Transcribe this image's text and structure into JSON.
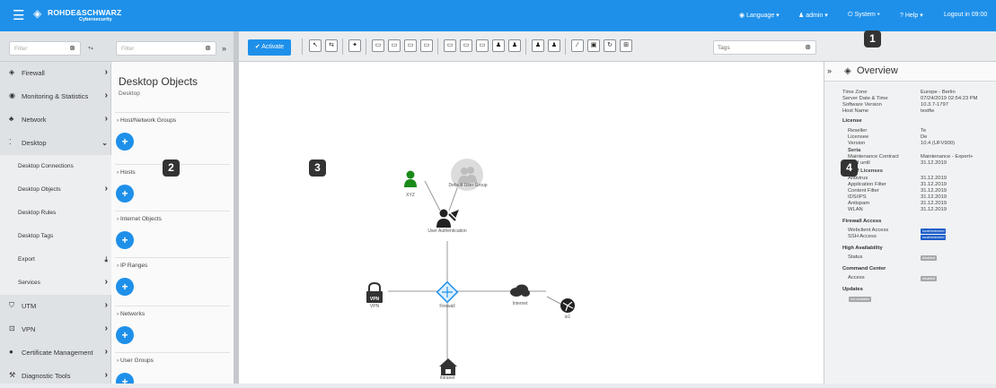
{
  "app": {
    "brand": "ROHDE&SCHWARZ",
    "subbrand": "Cybersecurity"
  },
  "topbar": {
    "language": "Language ▾",
    "user": "admin ▾",
    "system": "System ▾",
    "help": "Help ▾",
    "logout": "Logout in 09:00"
  },
  "filters": {
    "nav_placeholder": "Filter",
    "objects_placeholder": "Filter",
    "tags_placeholder": "Tags"
  },
  "nav": {
    "items": [
      {
        "label": "Firewall"
      },
      {
        "label": "Monitoring & Statistics"
      },
      {
        "label": "Network"
      },
      {
        "label": "Desktop"
      },
      {
        "label": "Desktop Connections"
      },
      {
        "label": "Desktop Objects"
      },
      {
        "label": "Desktop Rules"
      },
      {
        "label": "Desktop Tags"
      },
      {
        "label": "Export"
      },
      {
        "label": "Services"
      },
      {
        "label": "UTM"
      },
      {
        "label": "VPN"
      },
      {
        "label": "Certificate Management"
      },
      {
        "label": "Diagnostic Tools"
      }
    ]
  },
  "objects_panel": {
    "title": "Desktop Objects",
    "subtitle": "Desktop",
    "groups": [
      {
        "label": "Host/Network Groups"
      },
      {
        "label": "Hosts"
      },
      {
        "label": "Internet Objects"
      },
      {
        "label": "IP Ranges"
      },
      {
        "label": "Networks"
      },
      {
        "label": "User Groups"
      }
    ]
  },
  "toolbar": {
    "activate_label": "Activate"
  },
  "canvas": {
    "nodes": {
      "xyz": "XYZ",
      "default_user_group": "Default User Group",
      "user_auth": "User Authentication",
      "vpn": "VPN",
      "firewall": "Firewall",
      "internet": "Internet",
      "io1": "io1",
      "intranet": "Intranet"
    }
  },
  "overview": {
    "title": "Overview",
    "general": [
      {
        "key": "Time Zone",
        "value": "Europe - Berlin"
      },
      {
        "key": "Server Date & Time",
        "value": "07/24/2019 02:54:23 PM"
      },
      {
        "key": "Software Version",
        "value": "10.3.7-1797"
      },
      {
        "key": "Host Name",
        "value": "testfw"
      }
    ],
    "license_title": "License",
    "license": [
      {
        "key": "Reseller",
        "value": "Te"
      },
      {
        "key": "Licensee",
        "value": "De"
      },
      {
        "key": "Version",
        "value": "10.4 (UFV900)"
      }
    ],
    "serial_label": "Seria",
    "maint_key": "Maintenance Contract",
    "maint_value": "Maintenance - Expert+",
    "valid_key": "Valid until",
    "valid_value": "31.12.2019",
    "utm_title": "UTM Licenses",
    "utm": [
      {
        "key": "Antivirus",
        "value": "31.12.2019"
      },
      {
        "key": "Application Filter",
        "value": "31.12.2019"
      },
      {
        "key": "Content Filter",
        "value": "31.12.2019"
      },
      {
        "key": "IDS/IPS",
        "value": "31.12.2019"
      },
      {
        "key": "Antispam",
        "value": "31.12.2019"
      },
      {
        "key": "WLAN",
        "value": "31.12.2019"
      }
    ],
    "fw_title": "Firewall Access",
    "fw": [
      {
        "key": "Webclient Access",
        "value": "local/restricted"
      },
      {
        "key": "SSH Access",
        "value": "local/restricted"
      }
    ],
    "ha_title": "High Availability",
    "ha_status_key": "Status",
    "ha_status_value": "disabled",
    "cc_title": "Command Center",
    "cc_access_key": "Access",
    "cc_access_value": "disabled",
    "updates_title": "Updates",
    "updates_value": "not available"
  },
  "markers": {
    "m1": "1",
    "m2": "2",
    "m3": "3",
    "m4": "4"
  },
  "colors": {
    "brand_blue": "#1e90ea",
    "badge_blue": "#1c5ec9",
    "badge_gray": "#a6a8ab",
    "user_green": "#1a8a1a"
  }
}
